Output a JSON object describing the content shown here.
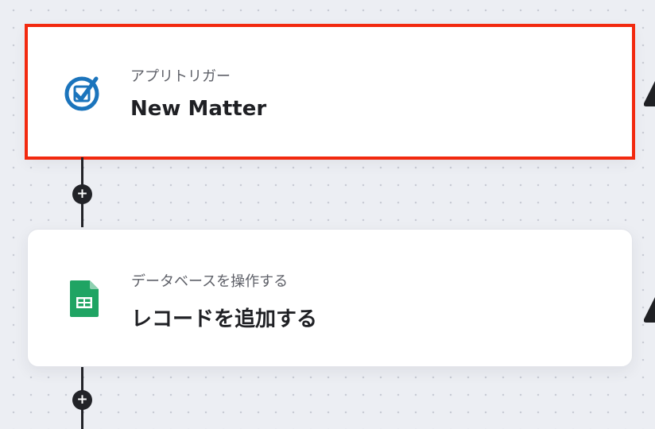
{
  "flow": {
    "trigger": {
      "category": "アプリトリガー",
      "title": "New Matter",
      "icon": "clio-checkmark-icon",
      "highlight_color": "#f2290f"
    },
    "action": {
      "category": "データベースを操作する",
      "title": "レコードを追加する",
      "icon": "google-sheets-icon"
    },
    "add_step_symbol": "+"
  },
  "colors": {
    "canvas_background": "#eceef3",
    "connector": "#222328",
    "trigger_icon_blue": "#1b74bc",
    "sheets_green": "#1fa463"
  }
}
